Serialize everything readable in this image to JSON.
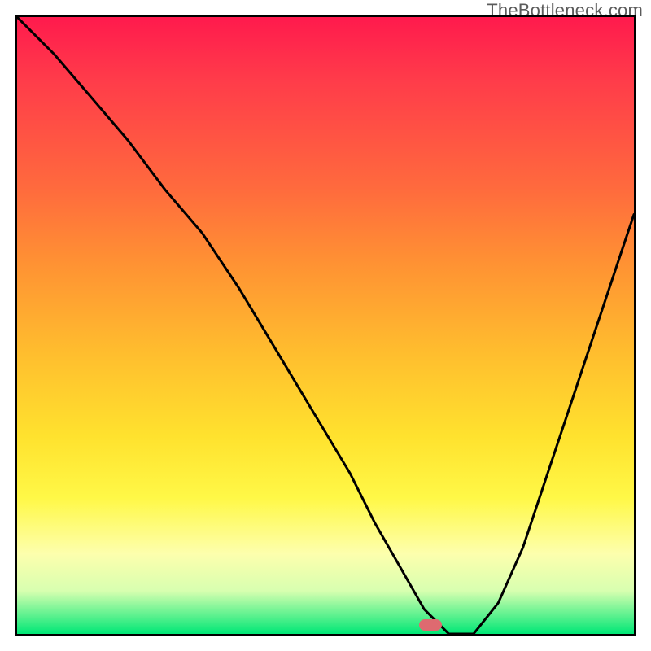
{
  "watermark": "TheBottleneck.com",
  "chart_data": {
    "type": "line",
    "title": "",
    "xlabel": "",
    "ylabel": "",
    "xlim": [
      0,
      100
    ],
    "ylim": [
      0,
      100
    ],
    "series": [
      {
        "name": "curve",
        "x": [
          0,
          6,
          12,
          18,
          24,
          30,
          36,
          42,
          48,
          54,
          58,
          62,
          66,
          70,
          74,
          78,
          82,
          86,
          90,
          94,
          98,
          100
        ],
        "y": [
          100,
          94,
          87,
          80,
          72,
          65,
          56,
          46,
          36,
          26,
          18,
          11,
          4,
          0,
          0,
          5,
          14,
          26,
          38,
          50,
          62,
          68
        ]
      }
    ],
    "marker": {
      "x": 67,
      "y": 1.5
    },
    "gradient_stops": [
      {
        "pos": 0.0,
        "color": "#ff1a4d"
      },
      {
        "pos": 0.28,
        "color": "#ff6b3d"
      },
      {
        "pos": 0.55,
        "color": "#ffbf2e"
      },
      {
        "pos": 0.78,
        "color": "#fff847"
      },
      {
        "pos": 0.93,
        "color": "#d8ffb0"
      },
      {
        "pos": 1.0,
        "color": "#00e776"
      }
    ]
  }
}
